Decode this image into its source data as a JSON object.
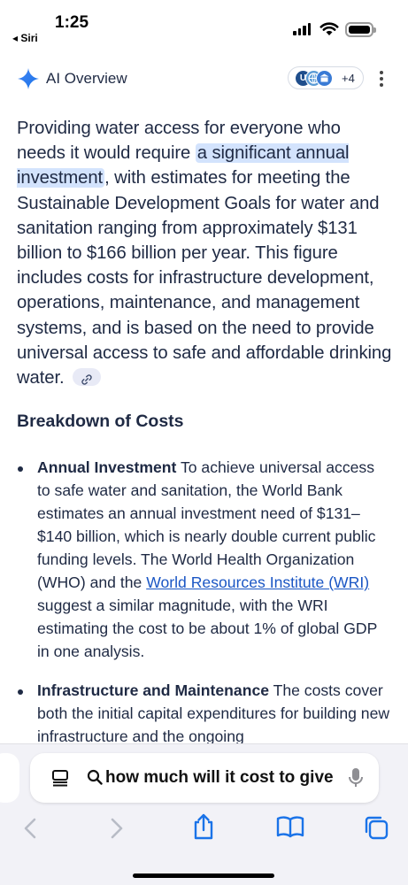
{
  "status": {
    "time": "1:25",
    "back_label": "◂ Siri"
  },
  "ai_overview": {
    "title": "AI Overview",
    "sources_badges": [
      "U",
      "",
      ""
    ],
    "sources_more": "+4",
    "colors": {
      "accent": "#4285f4",
      "highlight": "#d3e3fd",
      "link": "#1a56c4"
    }
  },
  "paragraph": {
    "p1": "Providing water access for everyone who needs it would require ",
    "highlight": "a significant annual investment",
    "p2": ", with estimates for meeting the Sustainable Development Goals for water and sanitation ranging from approximately $131 billion to $166 billion per year. This figure includes costs for infrastructure development, operations, maintenance, and management systems, and is based on the need to provide universal access to safe and affordable drinking water."
  },
  "section_heading": "Breakdown of Costs",
  "bullets": [
    {
      "title": "Annual Investment",
      "t1": " To achieve universal access to safe water and sanitation, the World Bank estimates an annual investment need of $131–$140 billion, which is nearly double current public funding levels. The World Health Organization (WHO) and the ",
      "link": "World Resources Institute (WRI)",
      "t2": " suggest a similar magnitude, with the WRI estimating the cost to be about 1% of global GDP in one analysis."
    },
    {
      "title": "Infrastructure and Maintenance",
      "t1": " The costs cover both the initial capital expenditures for building new infrastructure and the ongoing"
    }
  ],
  "search": {
    "query": "how much will it cost to give"
  },
  "toolbar": {
    "icons": [
      "back-icon",
      "forward-icon",
      "share-icon",
      "bookmarks-icon",
      "tabs-icon"
    ]
  }
}
